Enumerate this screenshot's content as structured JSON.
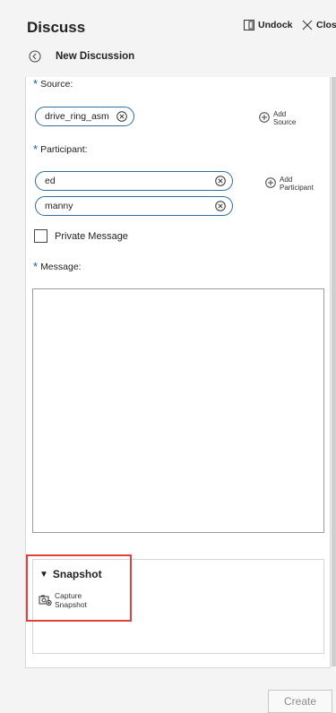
{
  "header": {
    "title": "Discuss",
    "undock_label": "Undock",
    "close_label": "Close"
  },
  "subheader": {
    "label": "New Discussion",
    "back_icon": "circle-arrow-left-icon"
  },
  "form": {
    "source": {
      "label": "Source:",
      "required": true,
      "items": [
        "drive_ring_asm"
      ],
      "add_label_line1": "Add",
      "add_label_line2": "Source"
    },
    "participant": {
      "label": "Participant:",
      "required": true,
      "items": [
        "ed",
        "manny"
      ],
      "add_label_line1": "Add",
      "add_label_line2": "Participant"
    },
    "private_message": {
      "label": "Private Message",
      "checked": false
    },
    "message": {
      "label": "Message:",
      "required": true,
      "value": ""
    }
  },
  "snapshot": {
    "title": "Snapshot",
    "capture_line1": "Capture",
    "capture_line2": "Snapshot"
  },
  "footer": {
    "create_label": "Create"
  },
  "colors": {
    "accent": "#2d6e98",
    "required_star": "#1c5d8c",
    "highlight": "#e0413c"
  }
}
